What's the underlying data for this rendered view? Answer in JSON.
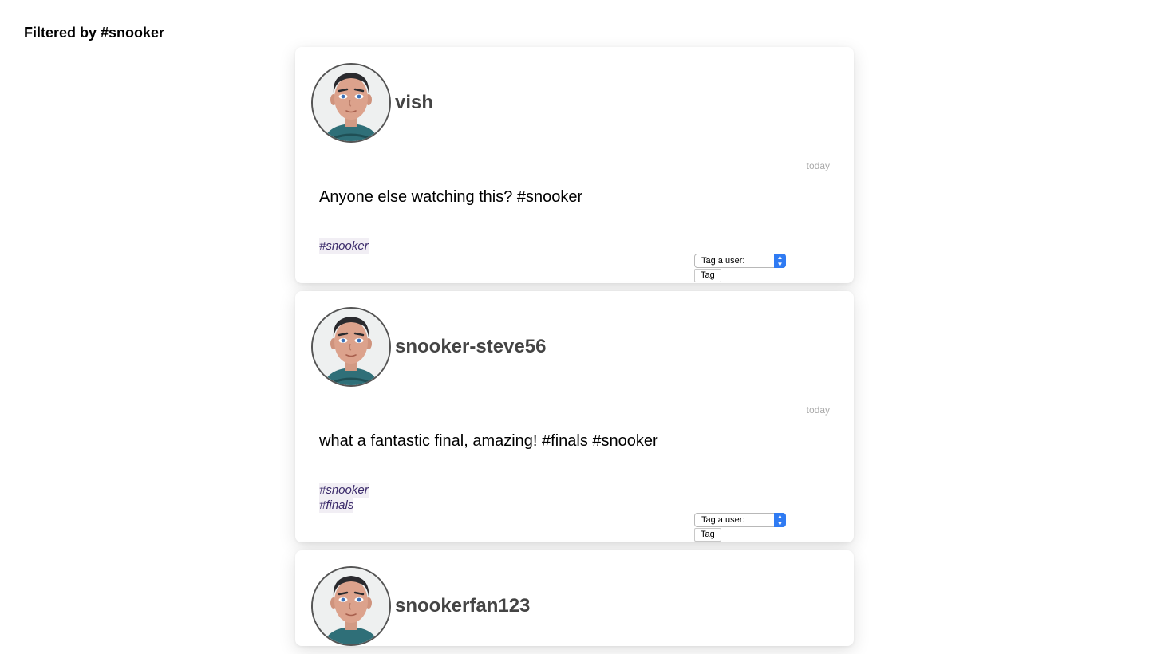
{
  "heading": "Filtered by #snooker",
  "posts": [
    {
      "username": "vish",
      "timestamp": "today",
      "body": "Anyone else watching this? #snooker",
      "tags": [
        "#snooker"
      ],
      "tag_select": "Tag a user:",
      "tag_button": "Tag"
    },
    {
      "username": "snooker-steve56",
      "timestamp": "today",
      "body": "what a fantastic final, amazing! #finals #snooker",
      "tags": [
        "#snooker",
        "#finals"
      ],
      "tag_select": "Tag a user:",
      "tag_button": "Tag"
    },
    {
      "username": "snookerfan123"
    }
  ],
  "colors": {
    "username": "#444444",
    "hashtag": "#3a2a6a",
    "hashtag_bg": "#f1eef4",
    "select_accent": "#2f7bf3"
  },
  "icons": {
    "avatar": "user-avatar-icon",
    "select_arrow": "chevron-up-down-icon"
  }
}
